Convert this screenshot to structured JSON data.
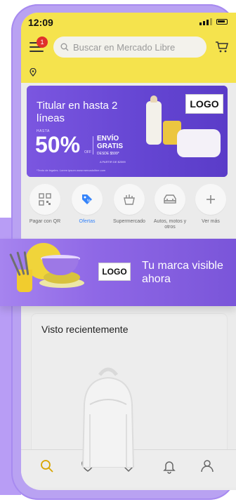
{
  "status": {
    "time": "12:09"
  },
  "header": {
    "notification_count": "1",
    "search_placeholder": "Buscar en Mercado Libre"
  },
  "banner": {
    "title": "Titular en hasta 2 líneas",
    "hasta_label": "HASTA",
    "discount": "50%",
    "off_label": "OFF",
    "envio_line1": "ENVÍO",
    "envio_line2": "GRATIS",
    "desde": "DESDE $599*",
    "a_partir": "A PARTIR DE $2599",
    "legal": "*Texto de legales. Lorem ipsum www.mercadolibre.com",
    "logo": "LOGO"
  },
  "categories": [
    {
      "label": "Pagar con QR",
      "icon": "qr-icon",
      "highlight": false
    },
    {
      "label": "Ofertas",
      "icon": "tag-icon",
      "highlight": true
    },
    {
      "label": "Supermercado",
      "icon": "basket-icon",
      "highlight": false
    },
    {
      "label": "Autos, motos y otros",
      "icon": "car-icon",
      "highlight": false
    },
    {
      "label": "Ver más",
      "icon": "plus-icon",
      "highlight": false
    }
  ],
  "ribbon": {
    "logo": "LOGO",
    "text": "Tu marca visible ahora"
  },
  "recent": {
    "title": "Visto recientemente"
  },
  "tabbar": [
    {
      "icon": "search-icon",
      "active": true
    },
    {
      "icon": "heart-icon",
      "active": false
    },
    {
      "icon": "tag-icon",
      "active": false
    },
    {
      "icon": "bell-icon",
      "active": false
    },
    {
      "icon": "user-icon",
      "active": false
    }
  ],
  "colors": {
    "header": "#f5e34d",
    "brand_purple": "#7b56e0",
    "active_blue": "#3483fa",
    "active_tab": "#d8a500"
  }
}
